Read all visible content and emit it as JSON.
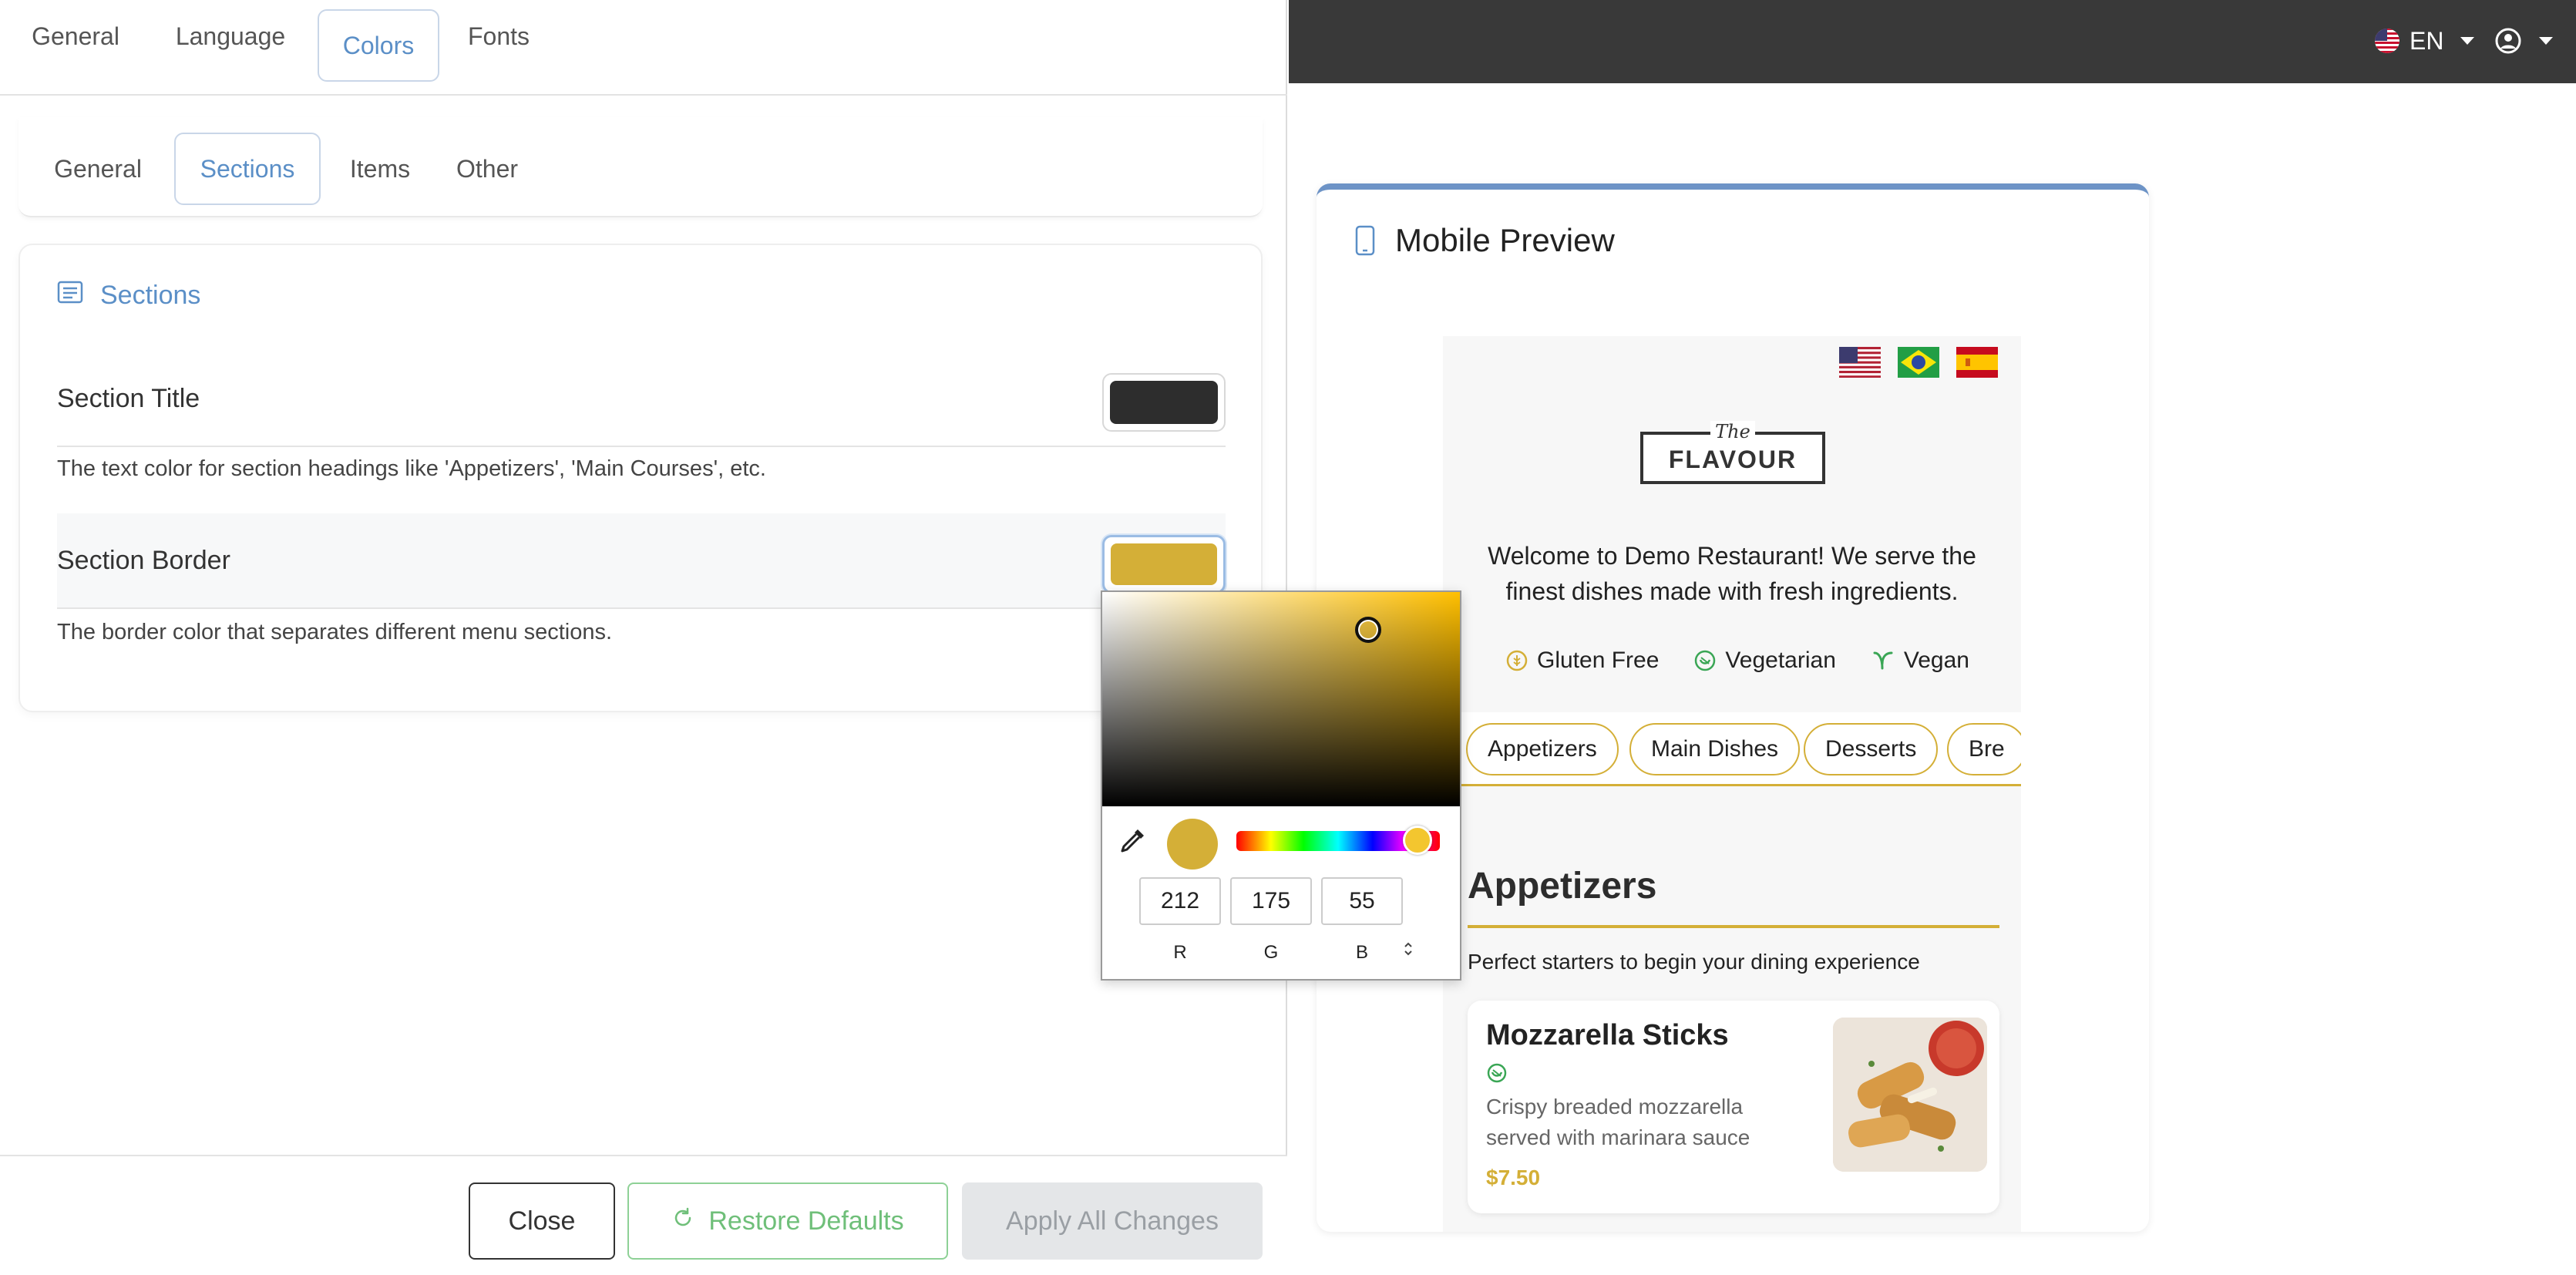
{
  "left": {
    "top_tabs": [
      {
        "label": "General"
      },
      {
        "label": "Language"
      },
      {
        "label": "Colors",
        "active": true
      },
      {
        "label": "Fonts"
      }
    ],
    "sub_tabs": [
      {
        "label": "General"
      },
      {
        "label": "Sections",
        "active": true
      },
      {
        "label": "Items"
      },
      {
        "label": "Other"
      }
    ],
    "card": {
      "title": "Sections",
      "icon": "list-icon",
      "fields": [
        {
          "label": "Section Title",
          "color": "#2d2d2d",
          "description": "The text color for section headings like 'Appetizers', 'Main Courses', etc."
        },
        {
          "label": "Section Border",
          "color": "#d4af37",
          "description": "The border color that separates different menu sections."
        }
      ]
    },
    "footer": {
      "close": "Close",
      "restore": "Restore Defaults",
      "apply": "Apply All Changes"
    }
  },
  "picker": {
    "r": "212",
    "g": "175",
    "b": "55",
    "r_label": "R",
    "g_label": "G",
    "b_label": "B",
    "current": "#d4af37"
  },
  "right": {
    "language": "EN",
    "preview_title": "Mobile Preview",
    "menu": {
      "logo_the": "The",
      "logo_name": "FLAVOUR",
      "welcome": "Welcome to Demo Restaurant! We serve the finest dishes made with fresh ingredients.",
      "diets": [
        {
          "label": "Gluten Free",
          "icon": "gluten-free-icon"
        },
        {
          "label": "Vegetarian",
          "icon": "vegetarian-icon"
        },
        {
          "label": "Vegan",
          "icon": "vegan-leaf-icon"
        }
      ],
      "categories": [
        "Appetizers",
        "Main Dishes",
        "Desserts",
        "Bre"
      ],
      "section": {
        "title": "Appetizers",
        "description": "Perfect starters to begin your dining experience"
      },
      "item": {
        "name": "Mozzarella Sticks",
        "description": "Crispy breaded mozzarella served with marinara sauce",
        "price": "$7.50"
      }
    }
  }
}
